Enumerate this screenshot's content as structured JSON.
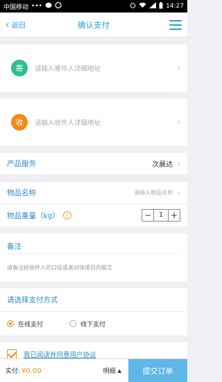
{
  "status_bar": {
    "carrier": "中国移动",
    "dots": "•••",
    "time": "14:27"
  },
  "nav": {
    "back_label": "返回",
    "title": "确认支付",
    "menu_icon": "hamburger-icon"
  },
  "sender": {
    "badge": "寄",
    "placeholder": "请输入寄件人详细地址"
  },
  "receiver": {
    "badge": "收",
    "placeholder": "请输入收件人详细地址"
  },
  "service": {
    "label": "产品服务",
    "value": "次晨达"
  },
  "item_name": {
    "label": "物品名称",
    "placeholder": "请输入物品名称"
  },
  "item_weight": {
    "label": "物品重量（kg）",
    "help": "?",
    "minus": "−",
    "value": "1",
    "plus": "+"
  },
  "note": {
    "label": "备注",
    "placeholder": "请备注给收件人的口信或者对快递员的留言"
  },
  "payment": {
    "label": "请选择支付方式",
    "options": [
      {
        "label": "在线支付",
        "selected": true
      },
      {
        "label": "线下支付",
        "selected": false
      }
    ]
  },
  "agreement": {
    "label": "我已阅读并同意用户协议",
    "checked": true
  },
  "footer": {
    "pay_label": "实付:",
    "amount": "¥0.00",
    "detail_label": "明细",
    "detail_arrow": "▲",
    "submit_label": "提交订单"
  },
  "colors": {
    "accent": "#27a0db",
    "orange": "#f08a1c",
    "green": "#2fbf86",
    "submit_bg": "#5fb7e6"
  }
}
